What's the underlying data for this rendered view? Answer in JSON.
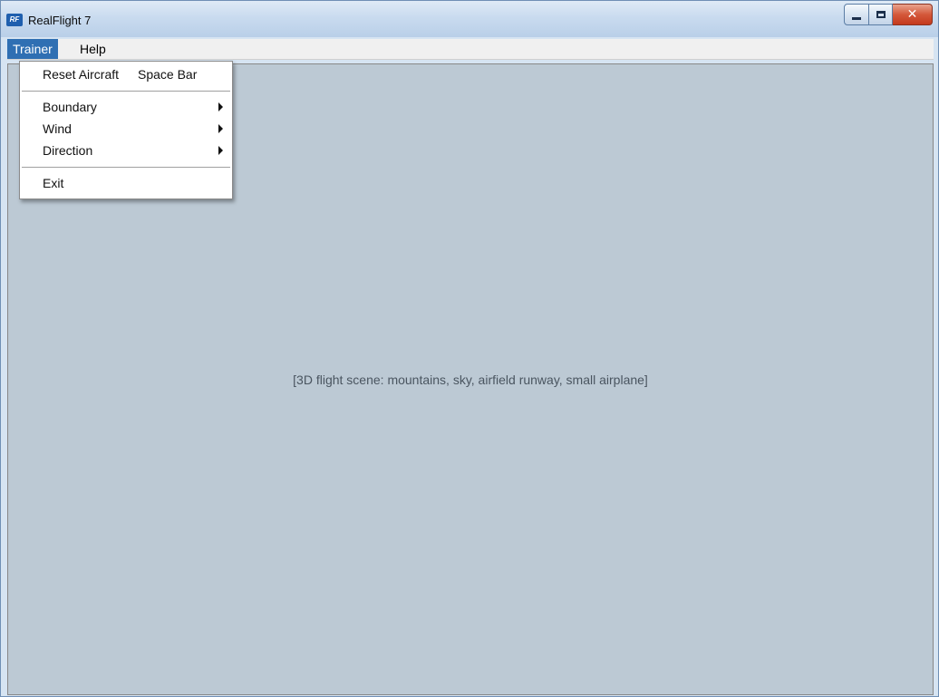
{
  "window": {
    "title": "RealFlight 7",
    "icon_text": "RF"
  },
  "menubar": {
    "trainer_label": "Trainer",
    "help_label": "Help"
  },
  "trainer_menu": {
    "reset_label": "Reset Aircraft",
    "reset_shortcut": "Space Bar",
    "boundary_label": "Boundary",
    "wind_label": "Wind",
    "direction_label": "Direction",
    "exit_label": "Exit"
  },
  "viewport": {
    "placeholder": "[3D flight scene: mountains, sky, airfield runway, small airplane]"
  }
}
